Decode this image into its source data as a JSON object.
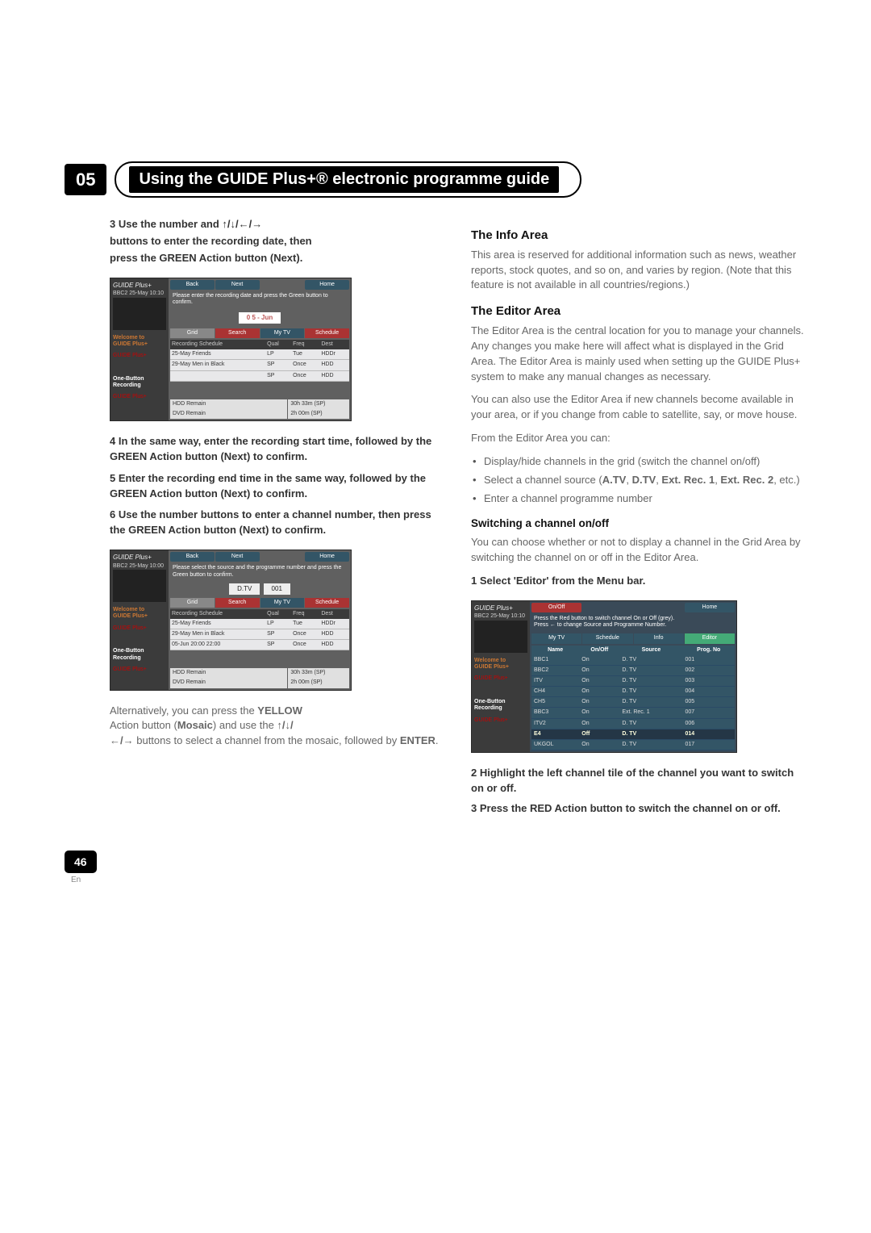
{
  "chapter": {
    "num": "05",
    "title": "Using the GUIDE Plus+® electronic programme guide"
  },
  "left": {
    "step3_prefix": "3    Use the number and ",
    "step3_arrows": "↑/↓/←/→",
    "step3_line2": "buttons to enter the recording date, then",
    "step3_line3": "press the GREEN Action button (Next).",
    "ss1": {
      "status": "BBC2   25-May  10:10",
      "btn_back": "Back",
      "btn_next": "Next",
      "btn_home": "Home",
      "instr": "Please enter the recording date and press the Green button to confirm.",
      "box": "0 5  -  Jun",
      "tabs": [
        "Grid",
        "Search",
        "My TV",
        "Schedule"
      ],
      "hdr": [
        "Recording Schedule",
        "Qual",
        "Freq",
        "Dest"
      ],
      "rows": [
        [
          "25-May  Friends",
          "LP",
          "Tue",
          "HDDr"
        ],
        [
          "29-May  Men in Black",
          "SP",
          "Once",
          "HDD"
        ],
        [
          "",
          "SP",
          "Once",
          "HDD"
        ]
      ],
      "remain_hdd_l": "HDD Remain",
      "remain_hdd_v": "30h 33m (SP)",
      "remain_dvd_l": "DVD Remain",
      "remain_dvd_v": "2h 00m (SP)",
      "side_welcome": "Welcome to",
      "side_guide": "GUIDE Plus+",
      "side_obr1": "One-Button",
      "side_obr2": "Recording",
      "brand_logo": "GUIDE Plus+"
    },
    "step4": "4    In the same way, enter the recording start time, followed by the GREEN Action button (Next) to confirm.",
    "step5": "5    Enter the recording end time in the same way, followed by the GREEN Action button (Next) to confirm.",
    "step6": "6    Use the number buttons to enter a channel number, then press the GREEN Action button (Next) to confirm.",
    "ss2": {
      "status": "BBC2   25-May  10:00",
      "btn_back": "Back",
      "btn_next": "Next",
      "btn_home": "Home",
      "instr": "Please select the source and the programme number and press the Green button to confirm.",
      "box_left": "D.TV",
      "box_right": "001",
      "tabs": [
        "Grid",
        "Search",
        "My TV",
        "Schedule"
      ],
      "hdr": [
        "Recording Schedule",
        "Qual",
        "Freq",
        "Dest"
      ],
      "rows": [
        [
          "25-May  Friends",
          "LP",
          "Tue",
          "HDDr"
        ],
        [
          "29-May  Men in Black",
          "SP",
          "Once",
          "HDD"
        ],
        [
          "05-Jun  20:00  22:00",
          "SP",
          "Once",
          "HDD"
        ]
      ],
      "remain_hdd_l": "HDD Remain",
      "remain_hdd_v": "30h 33m (SP)",
      "remain_dvd_l": "DVD Remain",
      "remain_dvd_v": "2h 00m (SP)"
    },
    "alt_p1": "Alternatively, you can press the ",
    "alt_yellow": "YELLOW",
    "alt_p2": "Action button (",
    "alt_mosaic": "Mosaic",
    "alt_p3": ") and use the ",
    "alt_arrows1": "↑/↓/",
    "alt_arrows2": "←/→",
    "alt_p4": " buttons to select a channel from the mosaic, followed by ",
    "alt_enter": "ENTER",
    "alt_p5": "."
  },
  "right": {
    "info_head": "The Info Area",
    "info_body": "This area is reserved for additional information such as news, weather reports, stock quotes, and so on, and varies by region. (Note that this feature is not available in all countries/regions.)",
    "editor_head": "The Editor Area",
    "editor_p1": "The Editor Area is the central location for you to manage your channels. Any changes you make here will affect what is displayed in the Grid Area. The Editor Area is mainly used when setting up the GUIDE Plus+ system to make any manual changes as necessary.",
    "editor_p2": "You can also use the Editor Area if new channels become available in your area, or if you change from cable to satellite, say, or move house.",
    "editor_p3": "From the Editor Area you can:",
    "bullet1": "Display/hide channels in the grid (switch the channel on/off)",
    "bullet2a": "Select a channel source (",
    "bullet2b": "A.TV",
    "bullet2c": ", ",
    "bullet2d": "D.TV",
    "bullet2e": ", ",
    "bullet2f": "Ext. Rec. 1",
    "bullet2g": ", ",
    "bullet2h": "Ext. Rec. 2",
    "bullet2i": ", etc.)",
    "bullet3": "Enter a channel programme number",
    "switch_head": "Switching a channel on/off",
    "switch_body": "You can choose whether or not to display a channel in the Grid Area by switching the channel on or off in the Editor Area.",
    "step1": "1    Select 'Editor' from the Menu bar.",
    "ss3": {
      "status": "BBC2   25-May  10:10",
      "btn_onoff": "On/Off",
      "btn_home": "Home",
      "instr1": "Press the Red button to switch channel On or Off (grey).",
      "instr2": "Press ← to change Source and Programme Number.",
      "tabs": [
        "My TV",
        "Schedule",
        "Info",
        "Editor"
      ],
      "hdr": [
        "Name",
        "On/Off",
        "Source",
        "Prog. No"
      ],
      "rows": [
        [
          "BBC1",
          "On",
          "D. TV",
          "001"
        ],
        [
          "BBC2",
          "On",
          "D. TV",
          "002"
        ],
        [
          "ITV",
          "On",
          "D. TV",
          "003"
        ],
        [
          "CH4",
          "On",
          "D. TV",
          "004"
        ],
        [
          "CH5",
          "On",
          "D. TV",
          "005"
        ],
        [
          "BBC3",
          "On",
          "Ext. Rec. 1",
          "007"
        ],
        [
          "ITV2",
          "On",
          "D. TV",
          "006"
        ],
        [
          "E4",
          "Off",
          "D. TV",
          "014"
        ],
        [
          "UKGOL",
          "On",
          "D. TV",
          "017"
        ]
      ],
      "hl_row": 7
    },
    "step2": "2    Highlight the left channel tile of the channel you want to switch on or off.",
    "step3": "3    Press the RED Action button to switch the channel on or off."
  },
  "page": {
    "num": "46",
    "lang": "En"
  }
}
